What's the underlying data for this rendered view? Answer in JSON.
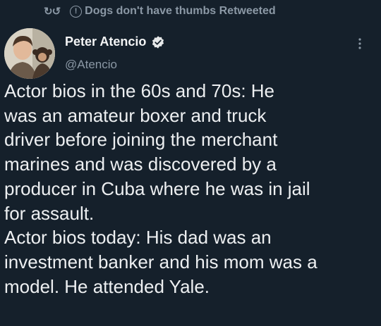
{
  "retweet": {
    "icon": "retweet-icon",
    "info_icon": "info-icon",
    "text": "Dogs don't have thumbs Retweeted"
  },
  "author": {
    "name": "Peter Atencio",
    "handle": "@Atencio",
    "verified_icon": "verified-badge-icon"
  },
  "tweet": {
    "lines": [
      "Actor bios in the 60s and 70s: He",
      "was an amateur boxer and truck",
      "driver before joining the merchant",
      "marines and was discovered by a",
      "producer in Cuba where he was in jail",
      "for assault.",
      "Actor bios today: His dad was an",
      "investment banker and his mom was a",
      "model. He attended Yale."
    ]
  },
  "colors": {
    "background": "#15202b",
    "muted": "#8b98a5",
    "text": "#e7e9ea"
  }
}
